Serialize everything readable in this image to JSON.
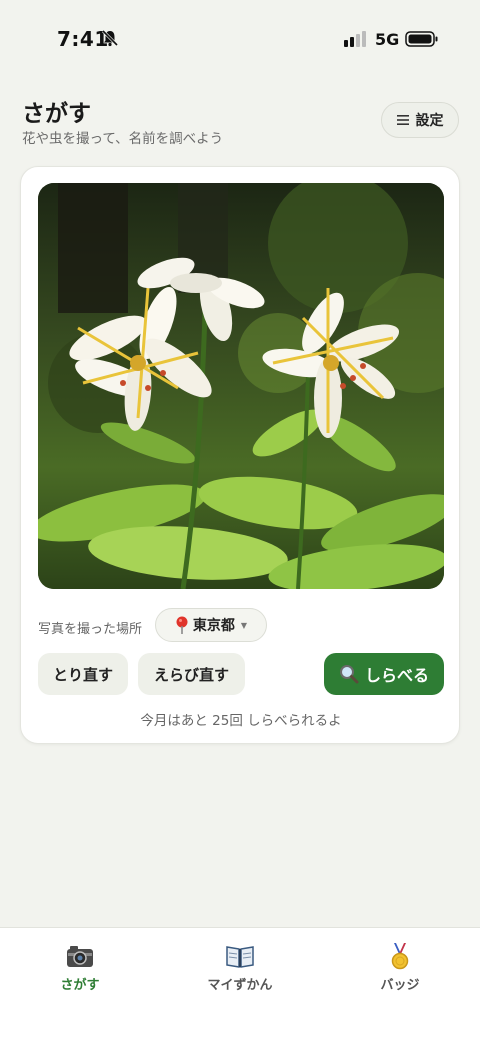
{
  "status_bar": {
    "time": "7:41",
    "network": "5G"
  },
  "header": {
    "title": "さがす",
    "subtitle": "花や虫を撮って、名前を調べよう",
    "settings_label": "設定"
  },
  "card": {
    "location_label": "写真を撮った場所",
    "location_value": "東京都",
    "retake_label": "とり直す",
    "reselect_label": "えらび直す",
    "search_label": "しらべる",
    "quota_text": "今月はあと 25回 しらべられるよ"
  },
  "tabs": [
    {
      "label": "さがす",
      "icon": "camera-icon",
      "active": true
    },
    {
      "label": "マイずかん",
      "icon": "book-icon",
      "active": false
    },
    {
      "label": "バッジ",
      "icon": "medal-icon",
      "active": false
    }
  ],
  "colors": {
    "accent": "#2e7d34",
    "background": "#f2f3ee",
    "card": "#ffffff"
  }
}
